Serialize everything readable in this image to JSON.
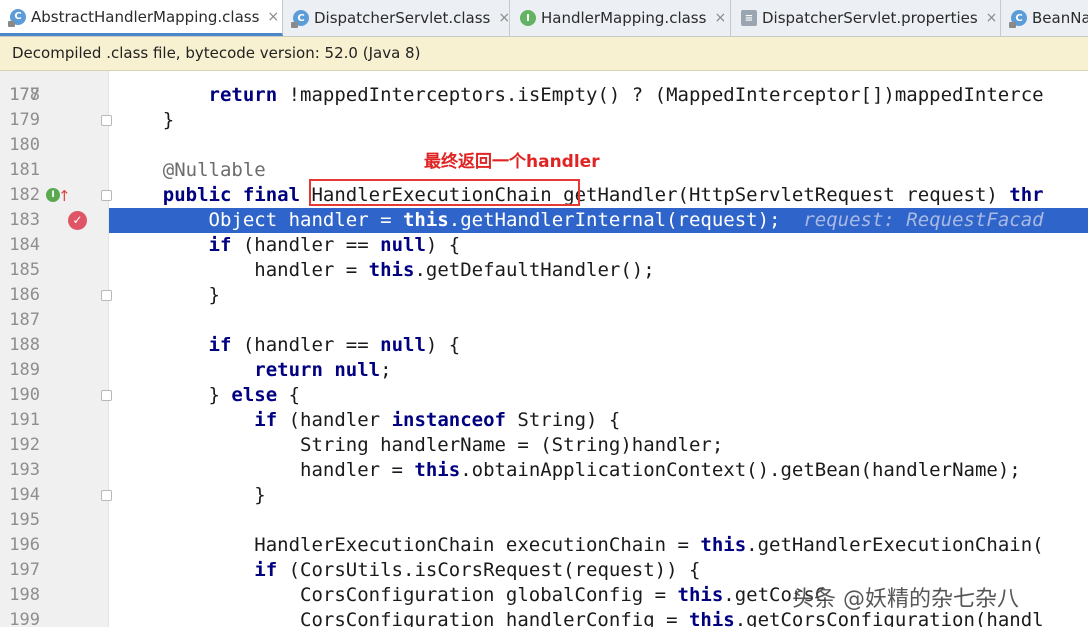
{
  "tabs": [
    {
      "label": "AbstractHandlerMapping.class",
      "icon": "class-file-icon",
      "glyph": "C",
      "active": true
    },
    {
      "label": "DispatcherServlet.class",
      "icon": "class-file-icon",
      "glyph": "C",
      "active": false
    },
    {
      "label": "HandlerMapping.class",
      "icon": "interface-file-icon",
      "glyph": "I",
      "active": false
    },
    {
      "label": "DispatcherServlet.properties",
      "icon": "properties-file-icon",
      "glyph": "≡",
      "active": false
    },
    {
      "label": "BeanNa",
      "icon": "class-file-icon",
      "glyph": "C",
      "active": false
    }
  ],
  "close_glyph": "×",
  "banner": {
    "text": "Decompiled .class file, bytecode version: 52.0 (Java 8)"
  },
  "callout": {
    "text": "最终返回一个handler"
  },
  "watermark": {
    "text": "头条 @妖精的杂七杂八"
  },
  "highlight_line": "183",
  "lines": [
    {
      "n": "178",
      "html": "        <span class=\"kw\">return</span> !mappedInterceptors.isEmpty() ? (MappedInterceptor[])mappedInterce"
    },
    {
      "n": "179",
      "html": "    }"
    },
    {
      "n": "180",
      "html": ""
    },
    {
      "n": "181",
      "html": "    <span class=\"annot-inline\">@Nullable</span>"
    },
    {
      "n": "182",
      "html": "    <span class=\"kw\">public final</span> HandlerExecutionChain getHandler(HttpServletRequest request) <span class=\"kw\">thr</span>"
    },
    {
      "n": "183",
      "html": "        Object handler = <span class=\"kw\">this</span>.getHandlerInternal(request);  <span class=\"hint\">request: RequestFacad</span>"
    },
    {
      "n": "184",
      "html": "        <span class=\"kw\">if</span> (handler == <span class=\"kw\">null</span>) {"
    },
    {
      "n": "185",
      "html": "            handler = <span class=\"kw\">this</span>.getDefaultHandler();"
    },
    {
      "n": "186",
      "html": "        }"
    },
    {
      "n": "187",
      "html": ""
    },
    {
      "n": "188",
      "html": "        <span class=\"kw\">if</span> (handler == <span class=\"kw\">null</span>) {"
    },
    {
      "n": "189",
      "html": "            <span class=\"kw\">return null</span>;"
    },
    {
      "n": "190",
      "html": "        } <span class=\"kw\">else</span> {"
    },
    {
      "n": "191",
      "html": "            <span class=\"kw\">if</span> (handler <span class=\"kw\">instanceof</span> String) {"
    },
    {
      "n": "192",
      "html": "                String handlerName = (String)handler;"
    },
    {
      "n": "193",
      "html": "                handler = <span class=\"kw\">this</span>.obtainApplicationContext().getBean(handlerName);"
    },
    {
      "n": "194",
      "html": "            }"
    },
    {
      "n": "195",
      "html": ""
    },
    {
      "n": "196",
      "html": "            HandlerExecutionChain executionChain = <span class=\"kw\">this</span>.getHandlerExecutionChain("
    },
    {
      "n": "197",
      "html": "            <span class=\"kw\">if</span> (CorsUtils.isCorsRequest(request)) {"
    },
    {
      "n": "198",
      "html": "                CorsConfiguration globalConfig = <span class=\"kw\">this</span>.getCorsC"
    },
    {
      "n": "199",
      "html": "                CorsConfiguration handlerConfig = <span class=\"kw\">this</span>.getCorsConfiguration(handl"
    }
  ],
  "gutter_markers": {
    "fold_lines": [
      "179",
      "182",
      "186",
      "190",
      "194"
    ],
    "implements_line": "182",
    "implements_glyph": "I",
    "override_glyph": "↑",
    "breakpoint_line": "183",
    "breakpoint_glyph": "✓"
  },
  "top_partial_line": "177"
}
